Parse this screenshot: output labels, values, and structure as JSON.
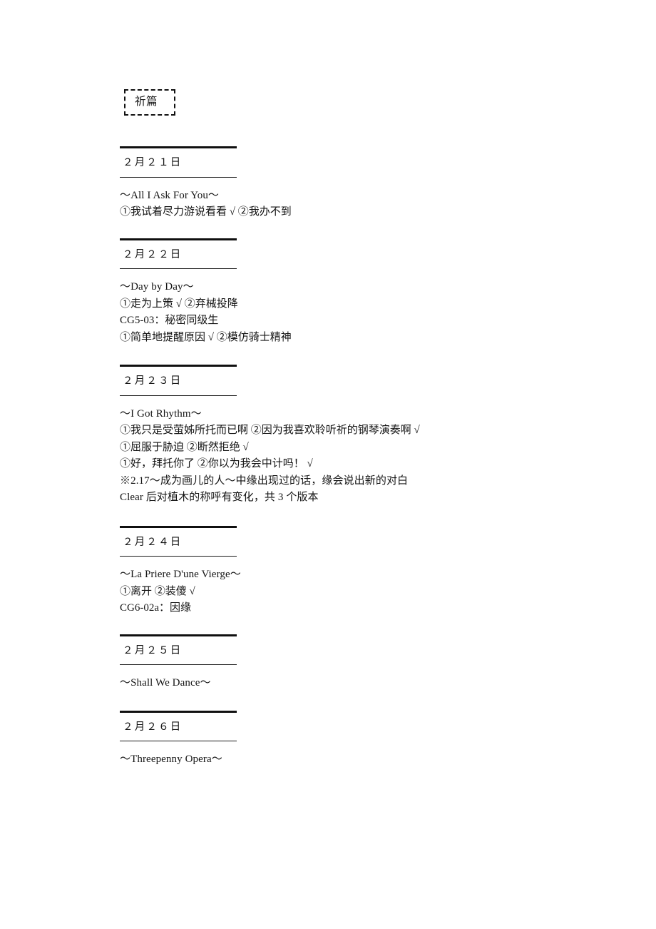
{
  "document": {
    "title_badge": "祈篇",
    "sections": [
      {
        "date": "２月２１日",
        "lines": [
          {
            "kind": "song",
            "text": "〜All I Ask For You〜"
          },
          {
            "kind": "choice",
            "text": "①我试着尽力游说看看 √  ②我办不到"
          }
        ]
      },
      {
        "date": "２月２２日",
        "lines": [
          {
            "kind": "song",
            "text": "〜Day by Day〜"
          },
          {
            "kind": "choice",
            "text": "①走为上策 √  ②弃械投降"
          },
          {
            "kind": "cg",
            "text": "CG5-03：秘密同级生"
          },
          {
            "kind": "choice",
            "text": "①简单地提醒原因 √  ②模仿骑士精神"
          }
        ]
      },
      {
        "date": "２月２３日",
        "lines": [
          {
            "kind": "song",
            "text": "〜I Got Rhythm〜"
          },
          {
            "kind": "choice",
            "text": "①我只是受萤姊所托而已啊  ②因为我喜欢聆听祈的钢琴演奏啊 √"
          },
          {
            "kind": "choice",
            "text": "①屈服于胁迫  ②断然拒绝 √"
          },
          {
            "kind": "choice",
            "text": "①好，拜托你了  ②你以为我会中计吗！ √"
          },
          {
            "kind": "note",
            "text": "※2.17〜成为画儿的人〜中缘出现过的话，缘会说出新的对白"
          },
          {
            "kind": "note",
            "text": "Clear 后对植木的称呼有变化，共 3 个版本"
          }
        ]
      },
      {
        "date": "２月２４日",
        "lines": [
          {
            "kind": "song",
            "text": "〜La Priere D'une Vierge〜"
          },
          {
            "kind": "choice",
            "text": "①离开 ②装傻 √"
          },
          {
            "kind": "cg",
            "text": "CG6-02a：因缘"
          }
        ]
      },
      {
        "date": "２月２５日",
        "lines": [
          {
            "kind": "song",
            "text": "〜Shall We Dance〜"
          }
        ]
      },
      {
        "date": "２月２６日",
        "lines": [
          {
            "kind": "song",
            "text": "〜Threepenny Opera〜"
          }
        ]
      }
    ]
  }
}
